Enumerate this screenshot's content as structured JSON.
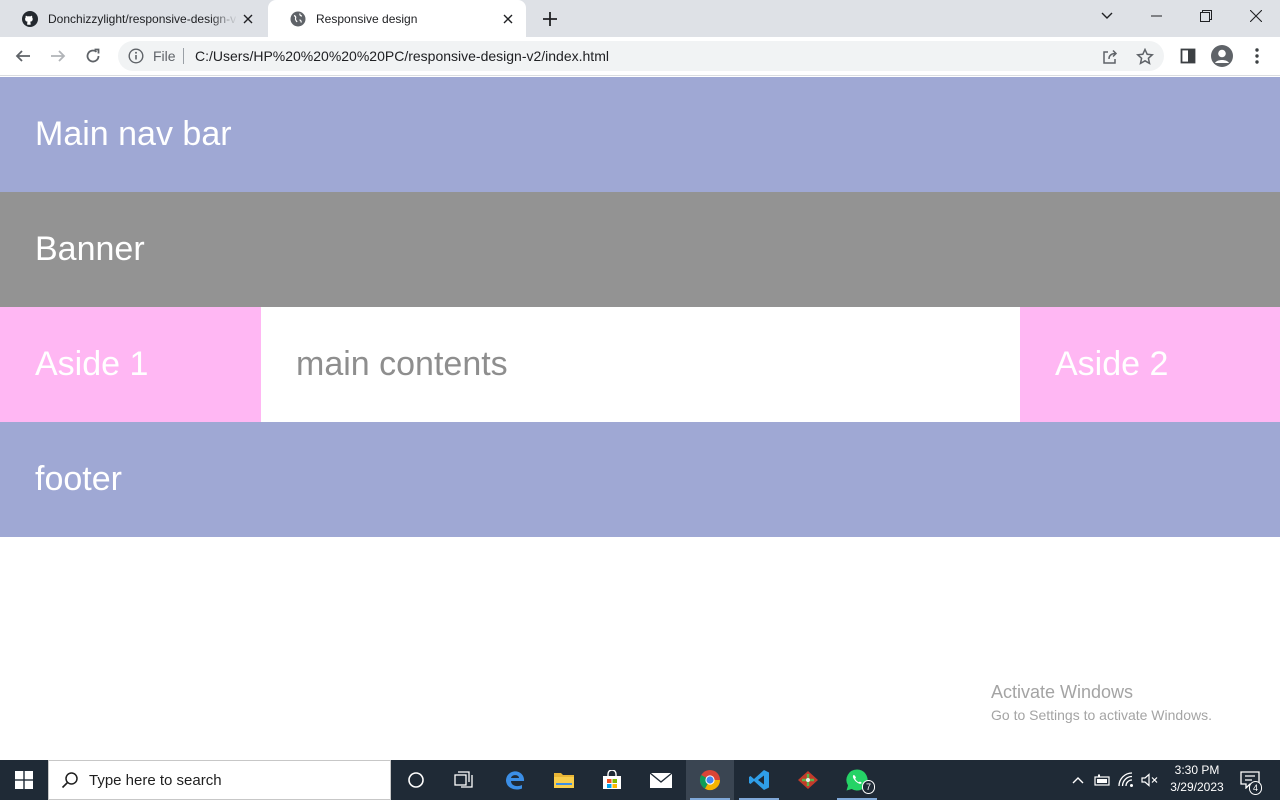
{
  "browser": {
    "tabs": [
      {
        "title": "Donchizzylight/responsive-design-v",
        "icon": "github-icon",
        "active": false
      },
      {
        "title": "Responsive design",
        "icon": "globe-icon",
        "active": true
      }
    ],
    "address": {
      "scheme": "File",
      "url": "C:/Users/HP%20%20%20%20PC/responsive-design-v2/index.html"
    }
  },
  "page": {
    "nav": "Main nav bar",
    "banner": "Banner",
    "aside1": "Aside 1",
    "main": "main contents",
    "aside2": "Aside 2",
    "footer": "footer"
  },
  "colors": {
    "nav": "#9fa8d4",
    "banner": "#939393",
    "aside": "#ffb7f3",
    "main_text": "#8e8e8e"
  },
  "watermark": {
    "line1": "Activate Windows",
    "line2": "Go to Settings to activate Windows."
  },
  "taskbar": {
    "search_placeholder": "Type here to search",
    "whatsapp_badge": "7",
    "notifications_badge": "4",
    "time": "3:30 PM",
    "date": "3/29/2023"
  }
}
